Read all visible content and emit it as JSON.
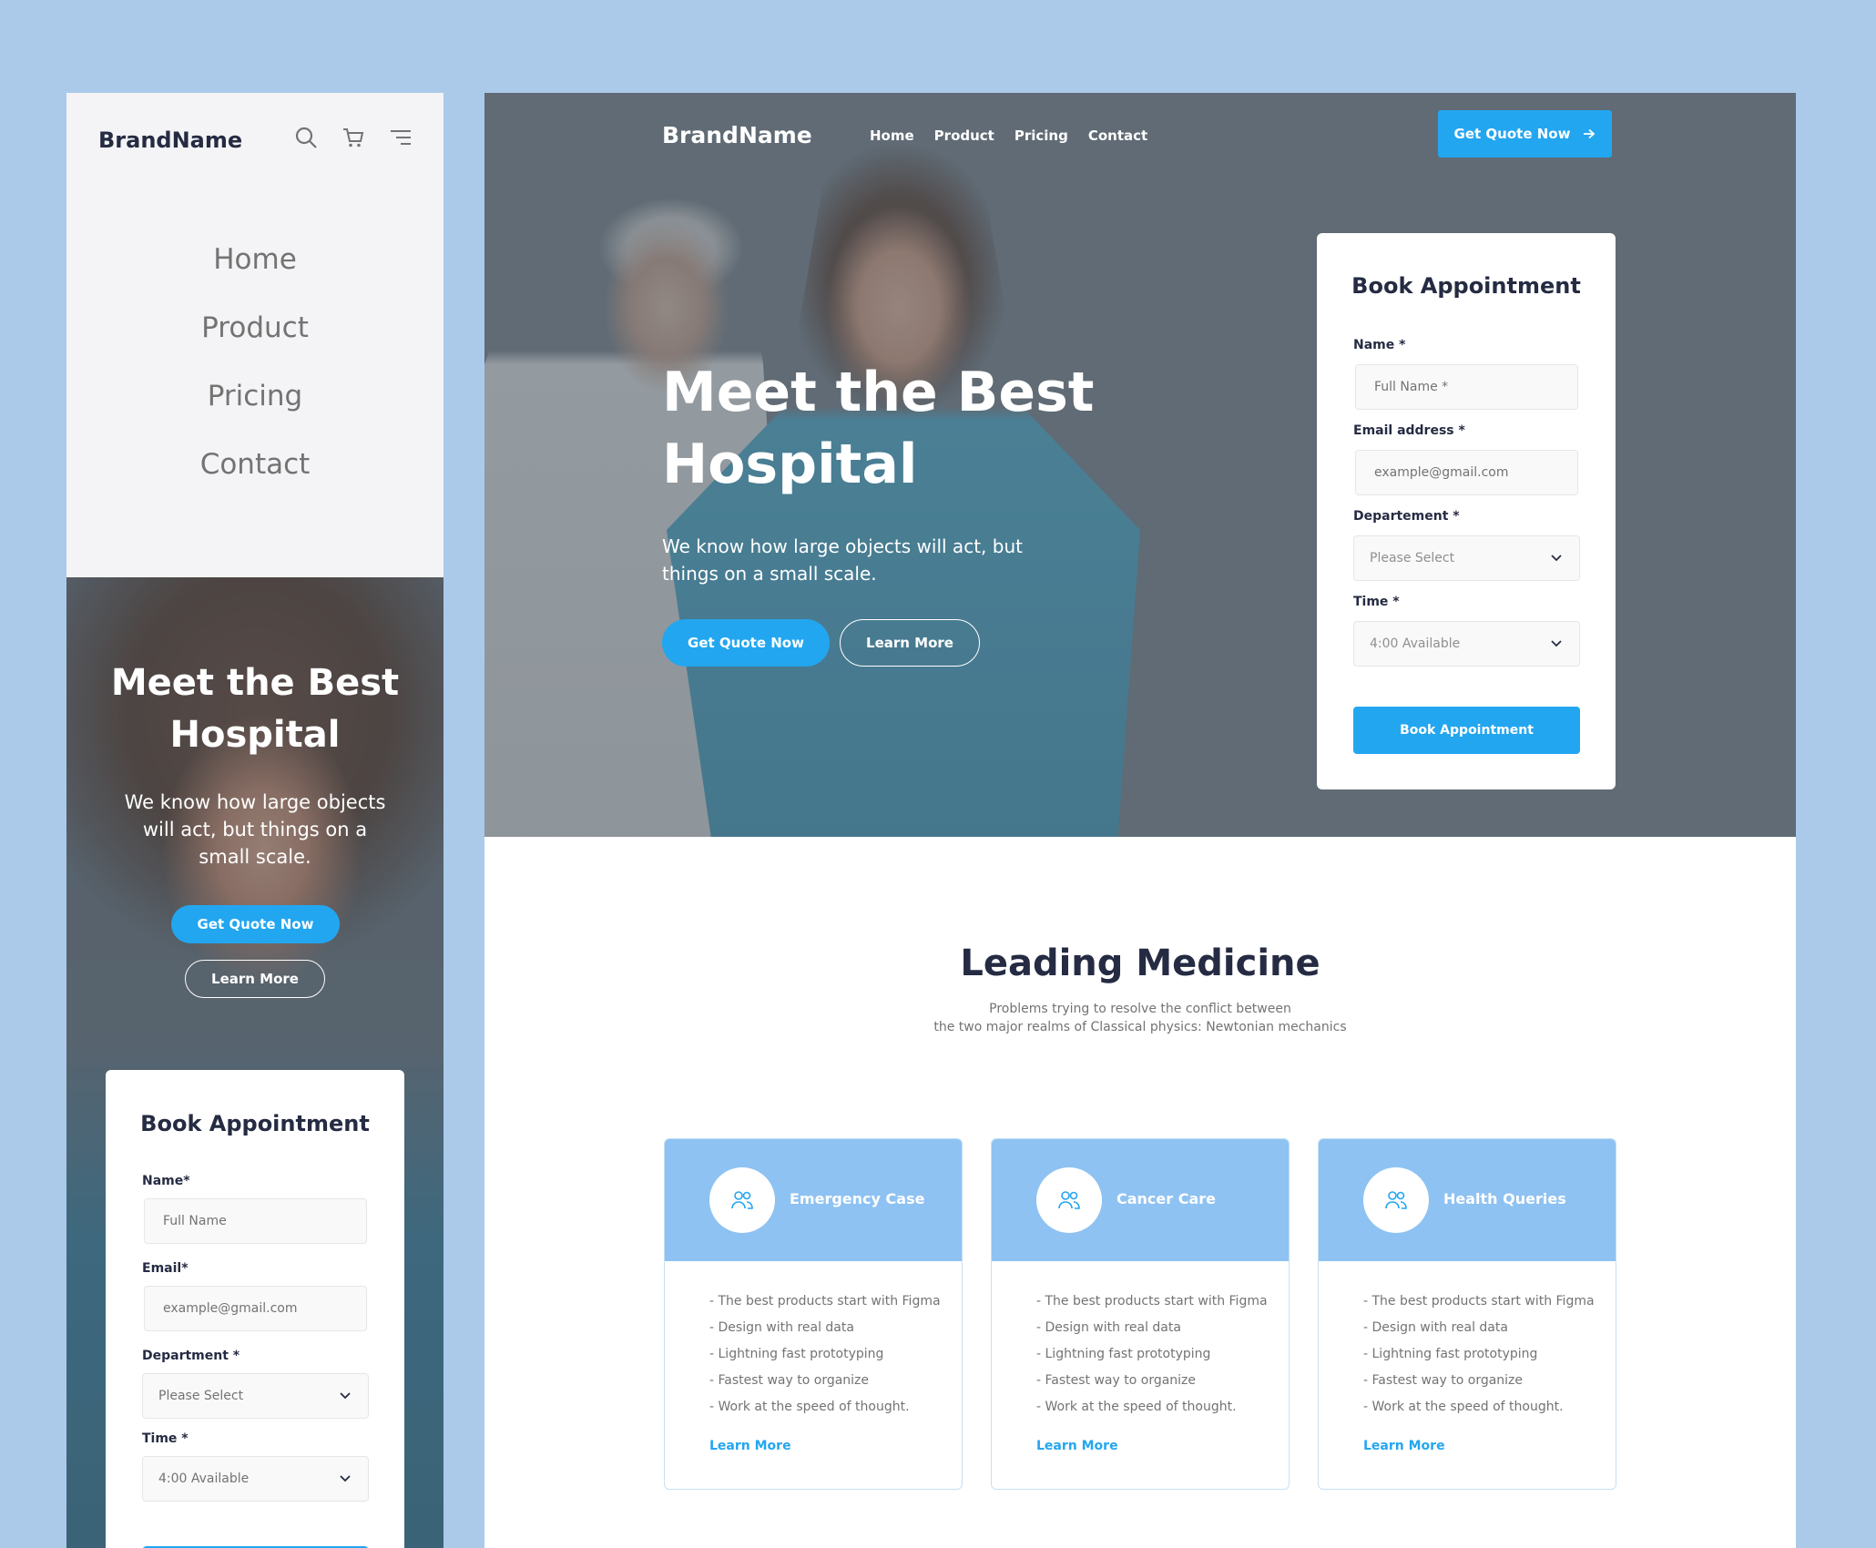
{
  "colors": {
    "background": "#abcaea",
    "primary": "#23a6f0",
    "card_header": "#8ec2f2",
    "text_dark": "#252b42",
    "text_muted": "#737373"
  },
  "mobile": {
    "brand": "BrandName",
    "icons": [
      "search-icon",
      "cart-icon",
      "menu-icon"
    ],
    "nav": [
      "Home",
      "Product",
      "Pricing",
      "Contact"
    ],
    "hero": {
      "title": "Meet the Best Hospital",
      "text": "We know how large objects will act, but things on a small scale.",
      "quote_button": "Get Quote Now",
      "learn_button": "Learn More"
    },
    "form": {
      "title": "Book Appointment",
      "name_label": "Name*",
      "name_placeholder": "Full Name",
      "email_label": "Email*",
      "email_placeholder": "example@gmail.com",
      "department_label": "Department *",
      "department_value": "Please Select",
      "time_label": "Time *",
      "time_value": "4:00 Available"
    }
  },
  "desktop": {
    "brand": "BrandName",
    "nav": [
      "Home",
      "Product",
      "Pricing",
      "Contact"
    ],
    "quote_button": "Get Quote Now",
    "hero": {
      "title": "Meet the Best Hospital",
      "text": "We know how large objects will act, but things on a small scale.",
      "quote_button": "Get Quote Now",
      "learn_button": "Learn More"
    },
    "form": {
      "title": "Book Appointment",
      "name_label": "Name *",
      "name_placeholder": "Full Name *",
      "email_label": "Email address *",
      "email_placeholder": "example@gmail.com",
      "department_label": "Departement *",
      "department_value": "Please Select",
      "time_label": "Time *",
      "time_value": "4:00 Available",
      "submit": "Book Appointment"
    },
    "section": {
      "title": "Leading Medicine",
      "subtitle_line1": "Problems trying to resolve the conflict between",
      "subtitle_line2": "the two major realms of Classical physics: Newtonian mechanics"
    },
    "services": [
      {
        "name": "Emergency Case",
        "icon": "users-icon",
        "items": [
          "-  The best products start with Figma",
          "- Design with real data",
          "- Lightning fast prototyping",
          "- Fastest way to organize",
          "- Work at the speed of thought."
        ],
        "link": "Learn More"
      },
      {
        "name": "Cancer Care",
        "icon": "users-icon",
        "items": [
          "-  The best products start with Figma",
          "- Design with real data",
          "- Lightning fast prototyping",
          "- Fastest way to organize",
          "- Work at the speed of thought."
        ],
        "link": "Learn More"
      },
      {
        "name": "Health Queries",
        "icon": "users-icon",
        "items": [
          "-  The best products start with Figma",
          "- Design with real data",
          "- Lightning fast prototyping",
          "- Fastest way to organize",
          "- Work at the speed of thought."
        ],
        "link": "Learn More"
      }
    ]
  }
}
